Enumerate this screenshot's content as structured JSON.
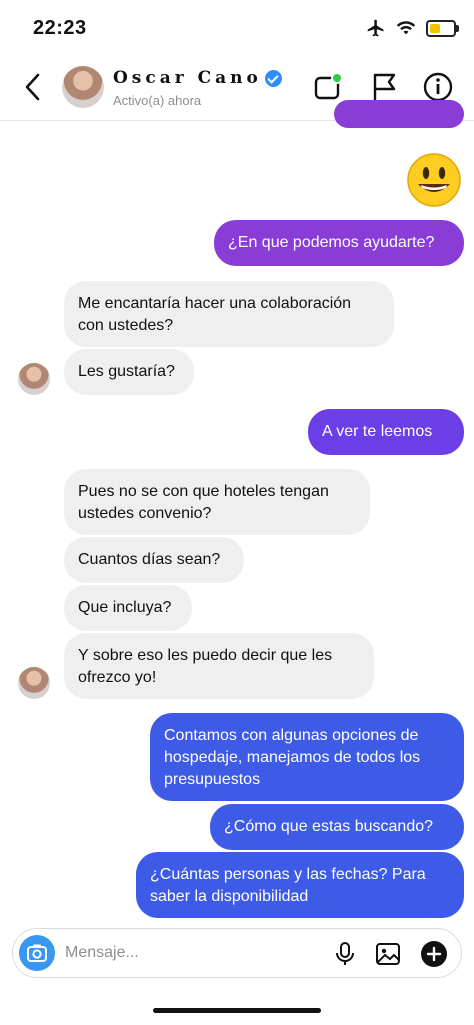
{
  "status_bar": {
    "time": "22:23",
    "icons": [
      "airplane-icon",
      "wifi-icon",
      "battery-icon"
    ],
    "battery_color": "#f2c200"
  },
  "header": {
    "contact_name": "Oscar Cano",
    "verified": true,
    "activity_status": "Activo(a) ahora",
    "icons": [
      "back-icon",
      "video-call-icon",
      "flag-icon",
      "info-icon"
    ],
    "online_dot_color": "#2ecc40"
  },
  "messages": [
    {
      "sender": "me",
      "type": "emoji",
      "text": "😃"
    },
    {
      "sender": "me",
      "text": "¿En que podemos ayudarte?"
    },
    {
      "sender": "contact",
      "text": "Me encantaría hacer una colaboración con ustedes?"
    },
    {
      "sender": "contact",
      "text": "Les gustaría?"
    },
    {
      "sender": "me",
      "text": "A ver te leemos"
    },
    {
      "sender": "contact",
      "text": "Pues no se con que hoteles tengan ustedes convenio?"
    },
    {
      "sender": "contact",
      "text": "Cuantos días sean?"
    },
    {
      "sender": "contact",
      "text": "Que incluya?"
    },
    {
      "sender": "contact",
      "text": "Y sobre eso les puedo decir que les ofrezco yo!"
    },
    {
      "sender": "me",
      "text": "Contamos con algunas opciones de hospedaje, manejamos de todos los presupuestos"
    },
    {
      "sender": "me",
      "text": "¿Cómo que estas buscando?"
    },
    {
      "sender": "me",
      "text": "¿Cuántas personas y las fechas? Para saber la disponibilidad"
    }
  ],
  "composer": {
    "placeholder": "Mensaje...",
    "icons": [
      "camera-icon",
      "microphone-icon",
      "gallery-icon",
      "add-icon"
    ]
  },
  "colors": {
    "incoming_bubble": "#efefef",
    "outgoing_purple": "#8a3dd6",
    "outgoing_violet": "#6b3ee6",
    "outgoing_blue": "#3e5be8",
    "accent_blue": "#3897f0"
  }
}
